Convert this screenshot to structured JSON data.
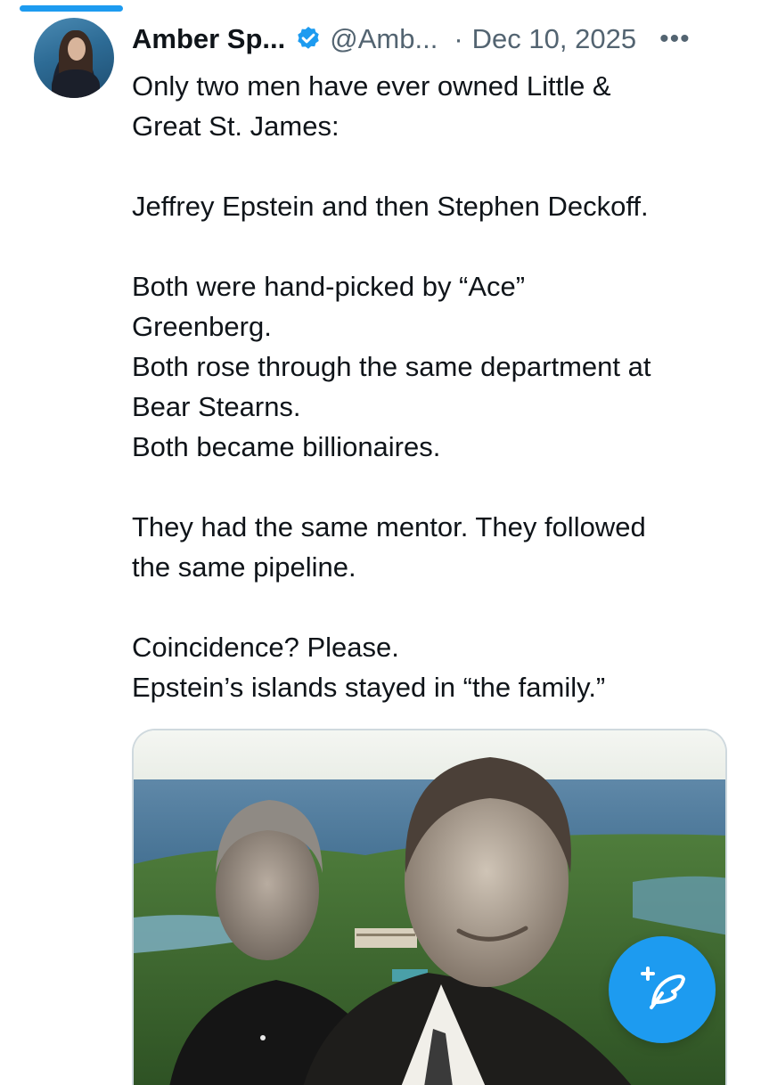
{
  "tweet": {
    "author_name": "Amber Sp...",
    "handle": "@Amb...",
    "separator": "·",
    "date": "Dec 10, 2025",
    "more_label": "•••",
    "lines": [
      "Only two men have ever owned Little &",
      "Great St. James:",
      "",
      "Jeffrey Epstein and then Stephen Deckoff.",
      "",
      "Both were hand-picked by “Ace”",
      "Greenberg.",
      "Both rose through the same department at",
      "Bear Stearns.",
      "Both became billionaires.",
      "",
      "They had the same mentor. They followed",
      "the same pipeline.",
      "",
      "Coincidence? Please.",
      "Epstein’s islands stayed in “the family.”"
    ]
  },
  "icons": {
    "verified": "verified-badge-icon",
    "more": "more-icon",
    "compose": "compose-feather-icon"
  },
  "colors": {
    "accent": "#1d9bf0",
    "secondary_text": "#536471",
    "primary_text": "#0f1419"
  }
}
